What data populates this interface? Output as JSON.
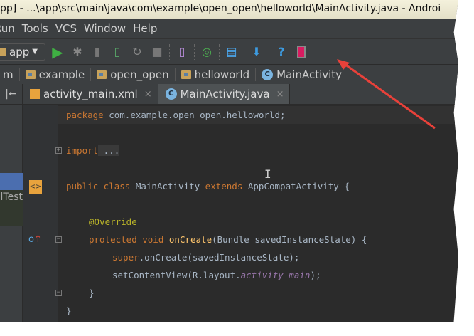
{
  "title": "pp] - ...\\app\\src\\main\\java\\com\\example\\open_open\\helloworld\\MainActivity.java - Androi",
  "menu": [
    "Run",
    "Tools",
    "VCS",
    "Window",
    "Help"
  ],
  "toolbar": {
    "run_config": "app"
  },
  "breadcrumb": [
    "m",
    "example",
    "open_open",
    "helloworld",
    "MainActivity"
  ],
  "tabs": [
    {
      "label": "activity_main.xml",
      "close": "×"
    },
    {
      "label": "MainActivity.java",
      "close": "×"
    }
  ],
  "left_panel": {
    "item": "lTest",
    "collapse": "|←"
  },
  "code": {
    "l1": [
      "package",
      " com.example.open_open.helloworld;"
    ],
    "l2": [
      "import",
      " ..."
    ],
    "l3": [
      "public class",
      " MainActivity ",
      "extends",
      " AppCompatActivity {"
    ],
    "l4": "@Override",
    "l5": [
      "protected void",
      " ",
      "onCreate",
      "(Bundle savedInstanceState) {"
    ],
    "l6": [
      "super",
      ".onCreate(savedInstanceState);"
    ],
    "l7": [
      "setContentView(R.layout.",
      "activity_main",
      ");"
    ],
    "l8": "}",
    "l9": "}"
  },
  "colors": {
    "keyword": "#cc7832",
    "annotation": "#bbb529",
    "arrow": "#e8413a"
  }
}
